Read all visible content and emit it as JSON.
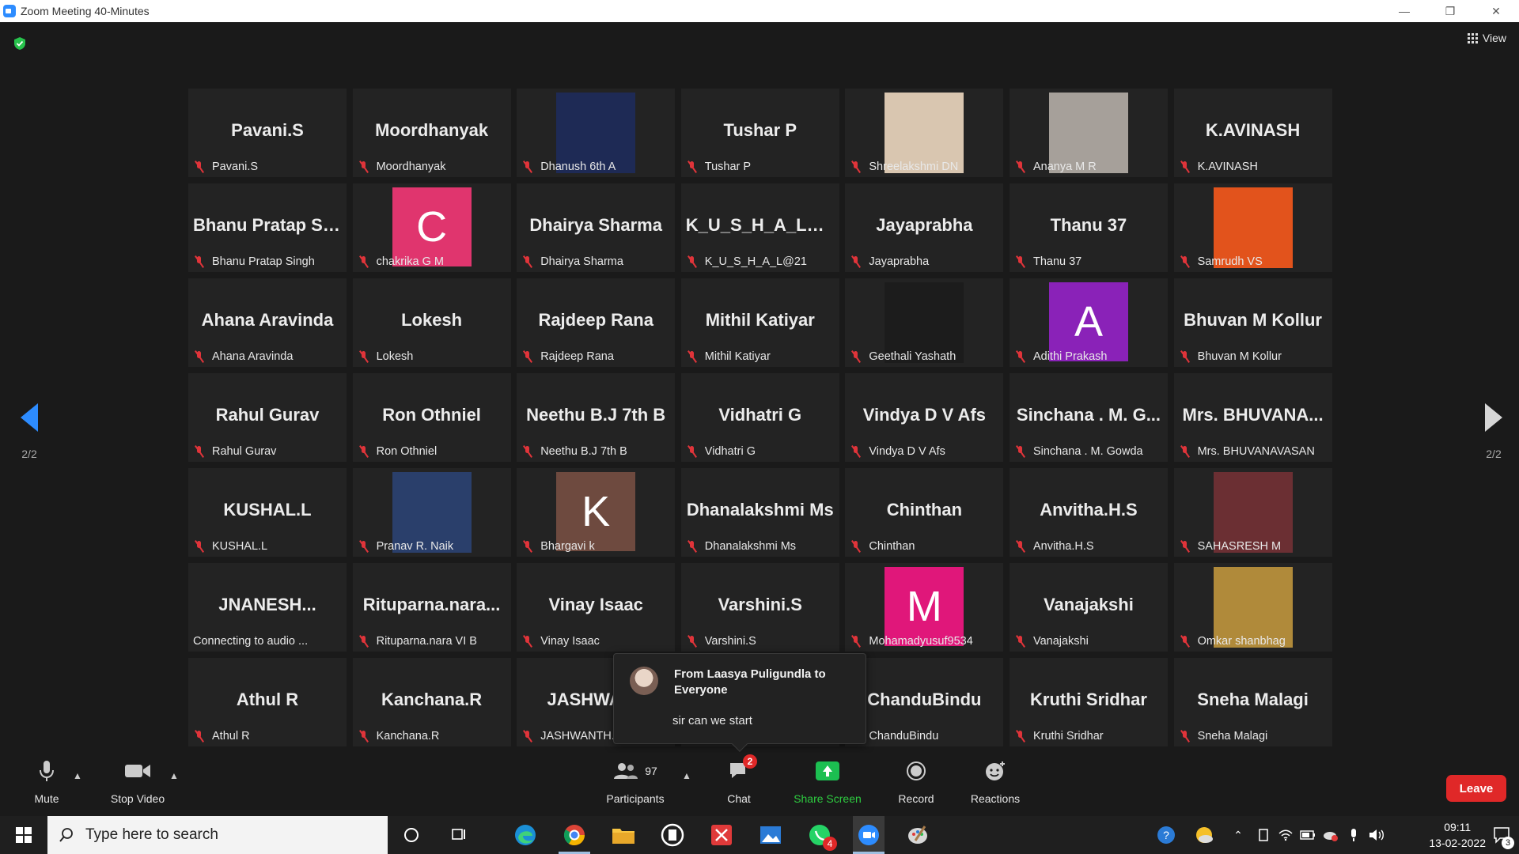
{
  "window": {
    "title": "Zoom Meeting 40-Minutes"
  },
  "view_button": {
    "label": "View"
  },
  "nav": {
    "left_page": "2/2",
    "right_page": "2/2"
  },
  "tiles": [
    {
      "big": "Pavani.S",
      "label": "Pavani.S"
    },
    {
      "big": "Moordhanyak",
      "label": "Moordhanyak"
    },
    {
      "big": "",
      "label": "Dhanush 6th A",
      "photo": "video-game-art",
      "photo_color": "#1e2a55"
    },
    {
      "big": "Tushar P",
      "label": "Tushar P"
    },
    {
      "big": "",
      "label": "Shreelakshmi DN",
      "photo": "child-photo",
      "photo_color": "#d9c6b0"
    },
    {
      "big": "",
      "label": "Ananya M R",
      "photo": "child-photo",
      "photo_color": "#a6a09a"
    },
    {
      "big": "K.AVINASH",
      "label": "K.AVINASH"
    },
    {
      "big": "Bhanu Pratap Si...",
      "label": "Bhanu Pratap Singh"
    },
    {
      "big": "",
      "label": "chakrika G M",
      "avatar": "C",
      "avatar_color": "#e0356e"
    },
    {
      "big": "Dhairya Sharma",
      "label": "Dhairya Sharma"
    },
    {
      "big": "K_U_S_H_A_L@21",
      "label": "K_U_S_H_A_L@21"
    },
    {
      "big": "Jayaprabha",
      "label": "Jayaprabha"
    },
    {
      "big": "Thanu 37",
      "label": "Thanu 37"
    },
    {
      "big": "",
      "label": "Samrudh VS",
      "photo": "cartoon-art",
      "photo_color": "#e2531c"
    },
    {
      "big": "Ahana Aravinda",
      "label": "Ahana Aravinda"
    },
    {
      "big": "Lokesh",
      "label": "Lokesh"
    },
    {
      "big": "Rajdeep Rana",
      "label": "Rajdeep Rana"
    },
    {
      "big": "Mithil Katiyar",
      "label": "Mithil Katiyar"
    },
    {
      "big": "",
      "label": "Geethali Yashath",
      "photo": "necklace-photo",
      "photo_color": "#1c1c1c"
    },
    {
      "big": "",
      "label": "Adithi Prakash",
      "avatar": "A",
      "avatar_color": "#8a22b8"
    },
    {
      "big": "Bhuvan M Kollur",
      "label": "Bhuvan M Kollur"
    },
    {
      "big": "Rahul Gurav",
      "label": "Rahul Gurav"
    },
    {
      "big": "Ron Othniel",
      "label": "Ron Othniel"
    },
    {
      "big": "Neethu B.J 7th B",
      "label": "Neethu B.J 7th B"
    },
    {
      "big": "Vidhatri G",
      "label": "Vidhatri G"
    },
    {
      "big": "Vindya D V Afs",
      "label": "Vindya D V Afs"
    },
    {
      "big": "Sinchana . M. G...",
      "label": "Sinchana . M. Gowda"
    },
    {
      "big": "Mrs. BHUVANA...",
      "label": "Mrs. BHUVANAVASAN"
    },
    {
      "big": "KUSHAL.L",
      "label": "KUSHAL.L"
    },
    {
      "big": "",
      "label": "Pranav R. Naik",
      "photo": "anime-art",
      "photo_color": "#2a3f6b"
    },
    {
      "big": "",
      "label": "Bhargavi k",
      "avatar": "K",
      "avatar_color": "#6e4a3f"
    },
    {
      "big": "Dhanalakshmi Ms",
      "label": "Dhanalakshmi Ms"
    },
    {
      "big": "Chinthan",
      "label": "Chinthan"
    },
    {
      "big": "Anvitha.H.S",
      "label": "Anvitha.H.S"
    },
    {
      "big": "",
      "label": "SAHASRESH M",
      "photo": "boy-photo",
      "photo_color": "#6b2f33"
    },
    {
      "big": "JNANESH...",
      "label": "Connecting to audio ...",
      "no_mic": true
    },
    {
      "big": "Rituparna.nara...",
      "label": "Rituparna.nara VI B"
    },
    {
      "big": "Vinay Isaac",
      "label": "Vinay Isaac"
    },
    {
      "big": "Varshini.S",
      "label": "Varshini.S"
    },
    {
      "big": "",
      "label": "Mohamadyusuf9534",
      "avatar": "M",
      "avatar_color": "#e0177a"
    },
    {
      "big": "Vanajakshi",
      "label": "Vanajakshi"
    },
    {
      "big": "",
      "label": "Omkar shanbhag",
      "photo": "boy-photo",
      "photo_color": "#b08a3a"
    },
    {
      "big": "Athul R",
      "label": "Athul R"
    },
    {
      "big": "Kanchana.R",
      "label": "Kanchana.R"
    },
    {
      "big": "JASHWANT",
      "label": "JASHWANTH."
    },
    {
      "big": "",
      "label": ""
    },
    {
      "big": "ChanduBindu",
      "label": "ChanduBindu"
    },
    {
      "big": "Kruthi Sridhar",
      "label": "Kruthi Sridhar"
    },
    {
      "big": "Sneha Malagi",
      "label": "Sneha Malagi"
    }
  ],
  "chat_popup": {
    "from": "From Laasya Puligundla to Everyone",
    "message": "sir can we start"
  },
  "toolbar": {
    "mute": "Mute",
    "stop_video": "Stop Video",
    "participants": "Participants",
    "participant_count": "97",
    "chat": "Chat",
    "chat_badge": "2",
    "share_screen": "Share Screen",
    "record": "Record",
    "reactions": "Reactions",
    "leave": "Leave"
  },
  "taskbar": {
    "search_placeholder": "Type here to search",
    "whatsapp_badge": "4",
    "time": "09:11",
    "date": "13-02-2022",
    "notifications": "3"
  },
  "colors": {
    "accent": "#2d8cff",
    "leave": "#e02828",
    "share": "#1cbf51",
    "muted_mic": "#e0343a"
  }
}
